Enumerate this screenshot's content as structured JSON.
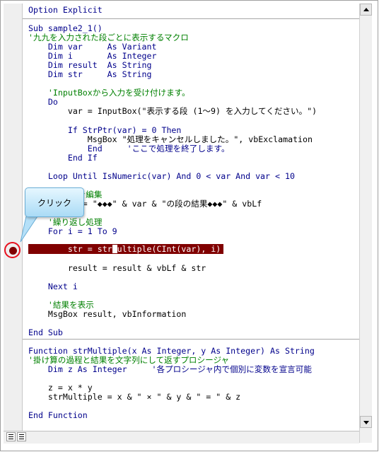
{
  "code": {
    "lines": [
      {
        "text": "Option Explicit",
        "kind": "keyword"
      },
      {
        "text": "Sub sample2_1()",
        "kind": "keyword"
      },
      {
        "text": "'九九を入力された段ごとに表示するマクロ",
        "kind": "comment"
      },
      {
        "text": "    Dim var     As Variant",
        "kind": "keyword"
      },
      {
        "text": "    Dim i       As Integer",
        "kind": "keyword"
      },
      {
        "text": "    Dim result  As String",
        "kind": "keyword"
      },
      {
        "text": "    Dim str     As String",
        "kind": "keyword"
      },
      {
        "text": "    'InputBoxから入力を受け付けます。",
        "kind": "comment"
      },
      {
        "text": "    Do",
        "kind": "keyword"
      },
      {
        "text": "        var = InputBox(\"表示する段 (1～9) を入力してください。\")",
        "kind": "plain"
      },
      {
        "text": "        If StrPtr(var) = 0 Then",
        "kind": "keyword"
      },
      {
        "text": "            MsgBox \"処理をキャンセルしました。\", vbExclamation",
        "kind": "plain"
      },
      {
        "text": "            End     'ここで処理を終了します。",
        "kind": "keyword"
      },
      {
        "text": "        End If",
        "kind": "keyword"
      },
      {
        "text": "    Loop Until IsNumeric(var) And 0 < var And var < 10",
        "kind": "keyword"
      },
      {
        "text": "    '見出しを編集",
        "kind": "comment"
      },
      {
        "text": "    result = \"◆◆◆\" & var & \"の段の結果◆◆◆\" & vbLf",
        "kind": "plain"
      },
      {
        "text": "    '繰り返し処理",
        "kind": "comment"
      },
      {
        "text": "    For i = 1 To 9",
        "kind": "keyword"
      },
      {
        "text": "        result = result & vbLf & str",
        "kind": "plain"
      },
      {
        "text": "    Next i",
        "kind": "keyword"
      },
      {
        "text": "    '結果を表示",
        "kind": "comment"
      },
      {
        "text": "    MsgBox result, vbInformation",
        "kind": "plain"
      },
      {
        "text": "End Sub",
        "kind": "keyword"
      },
      {
        "text": "Function strMultiple(x As Integer, y As Integer) As String",
        "kind": "keyword"
      },
      {
        "text": "'掛け算の過程と結果を文字列にして返すプロシージャ",
        "kind": "comment"
      },
      {
        "text": "    Dim z As Integer     '各プロシージャ内で個別に変数を宣言可能",
        "kind": "keyword"
      },
      {
        "text": "    z = x * y",
        "kind": "plain"
      },
      {
        "text": "    strMultiple = x & \" × \" & y & \" = \" & z",
        "kind": "plain"
      },
      {
        "text": "End Function",
        "kind": "keyword"
      }
    ],
    "breakpoint_line": {
      "before_cursor": "        str = str",
      "after_cursor": "ultiple(CInt(var), i)"
    }
  },
  "callout": {
    "label": "クリック"
  },
  "colors": {
    "keyword": "#00008b",
    "comment": "#008000",
    "plain": "#000000",
    "breakpoint_bg": "#800000",
    "annotation_ring": "#e8101e"
  },
  "icons": {
    "breakpoint": "breakpoint-dot-icon",
    "scroll_up": "scroll-up-arrow-icon",
    "scroll_down": "scroll-down-arrow-icon",
    "procedure_view": "procedure-view-icon",
    "full_module_view": "full-module-view-icon"
  }
}
